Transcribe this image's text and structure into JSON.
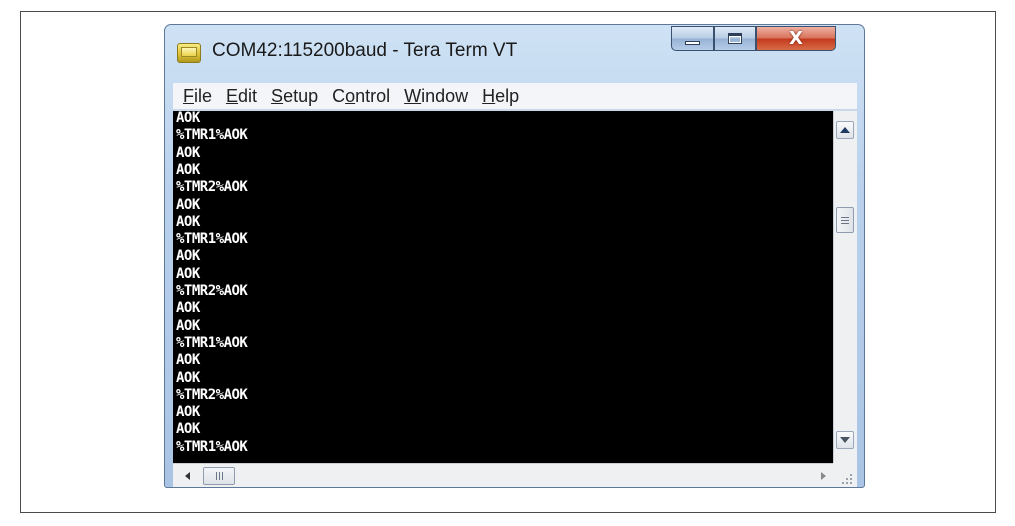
{
  "window": {
    "title": "COM42:115200baud - Tera Term VT",
    "icon": "teraterm-app-icon",
    "controls": {
      "minimize_icon": "minimize-icon",
      "maximize_icon": "maximize-icon",
      "close_label": "X"
    }
  },
  "menubar": {
    "items": [
      {
        "access_key": "F",
        "rest": "ile"
      },
      {
        "access_key": "E",
        "rest": "dit"
      },
      {
        "access_key": "S",
        "rest": "etup"
      },
      {
        "prefix": "C",
        "access_key": "o",
        "rest": "ntrol"
      },
      {
        "access_key": "W",
        "rest": "indow"
      },
      {
        "access_key": "H",
        "rest": "elp"
      }
    ]
  },
  "terminal": {
    "lines": [
      "AOK",
      "%TMR1%AOK",
      "AOK",
      "AOK",
      "%TMR2%AOK",
      "AOK",
      "AOK",
      "%TMR1%AOK",
      "AOK",
      "AOK",
      "%TMR2%AOK",
      "AOK",
      "AOK",
      "%TMR1%AOK",
      "AOK",
      "AOK",
      "%TMR2%AOK",
      "AOK",
      "AOK",
      "%TMR1%AOK"
    ],
    "background": "#000000",
    "foreground": "#ffffff"
  },
  "scrollbars": {
    "vertical": {
      "up_icon": "scroll-up-arrow-icon",
      "down_icon": "scroll-down-arrow-icon"
    },
    "horizontal": {
      "left_icon": "scroll-left-arrow-icon",
      "right_icon": "scroll-right-arrow-icon"
    }
  }
}
